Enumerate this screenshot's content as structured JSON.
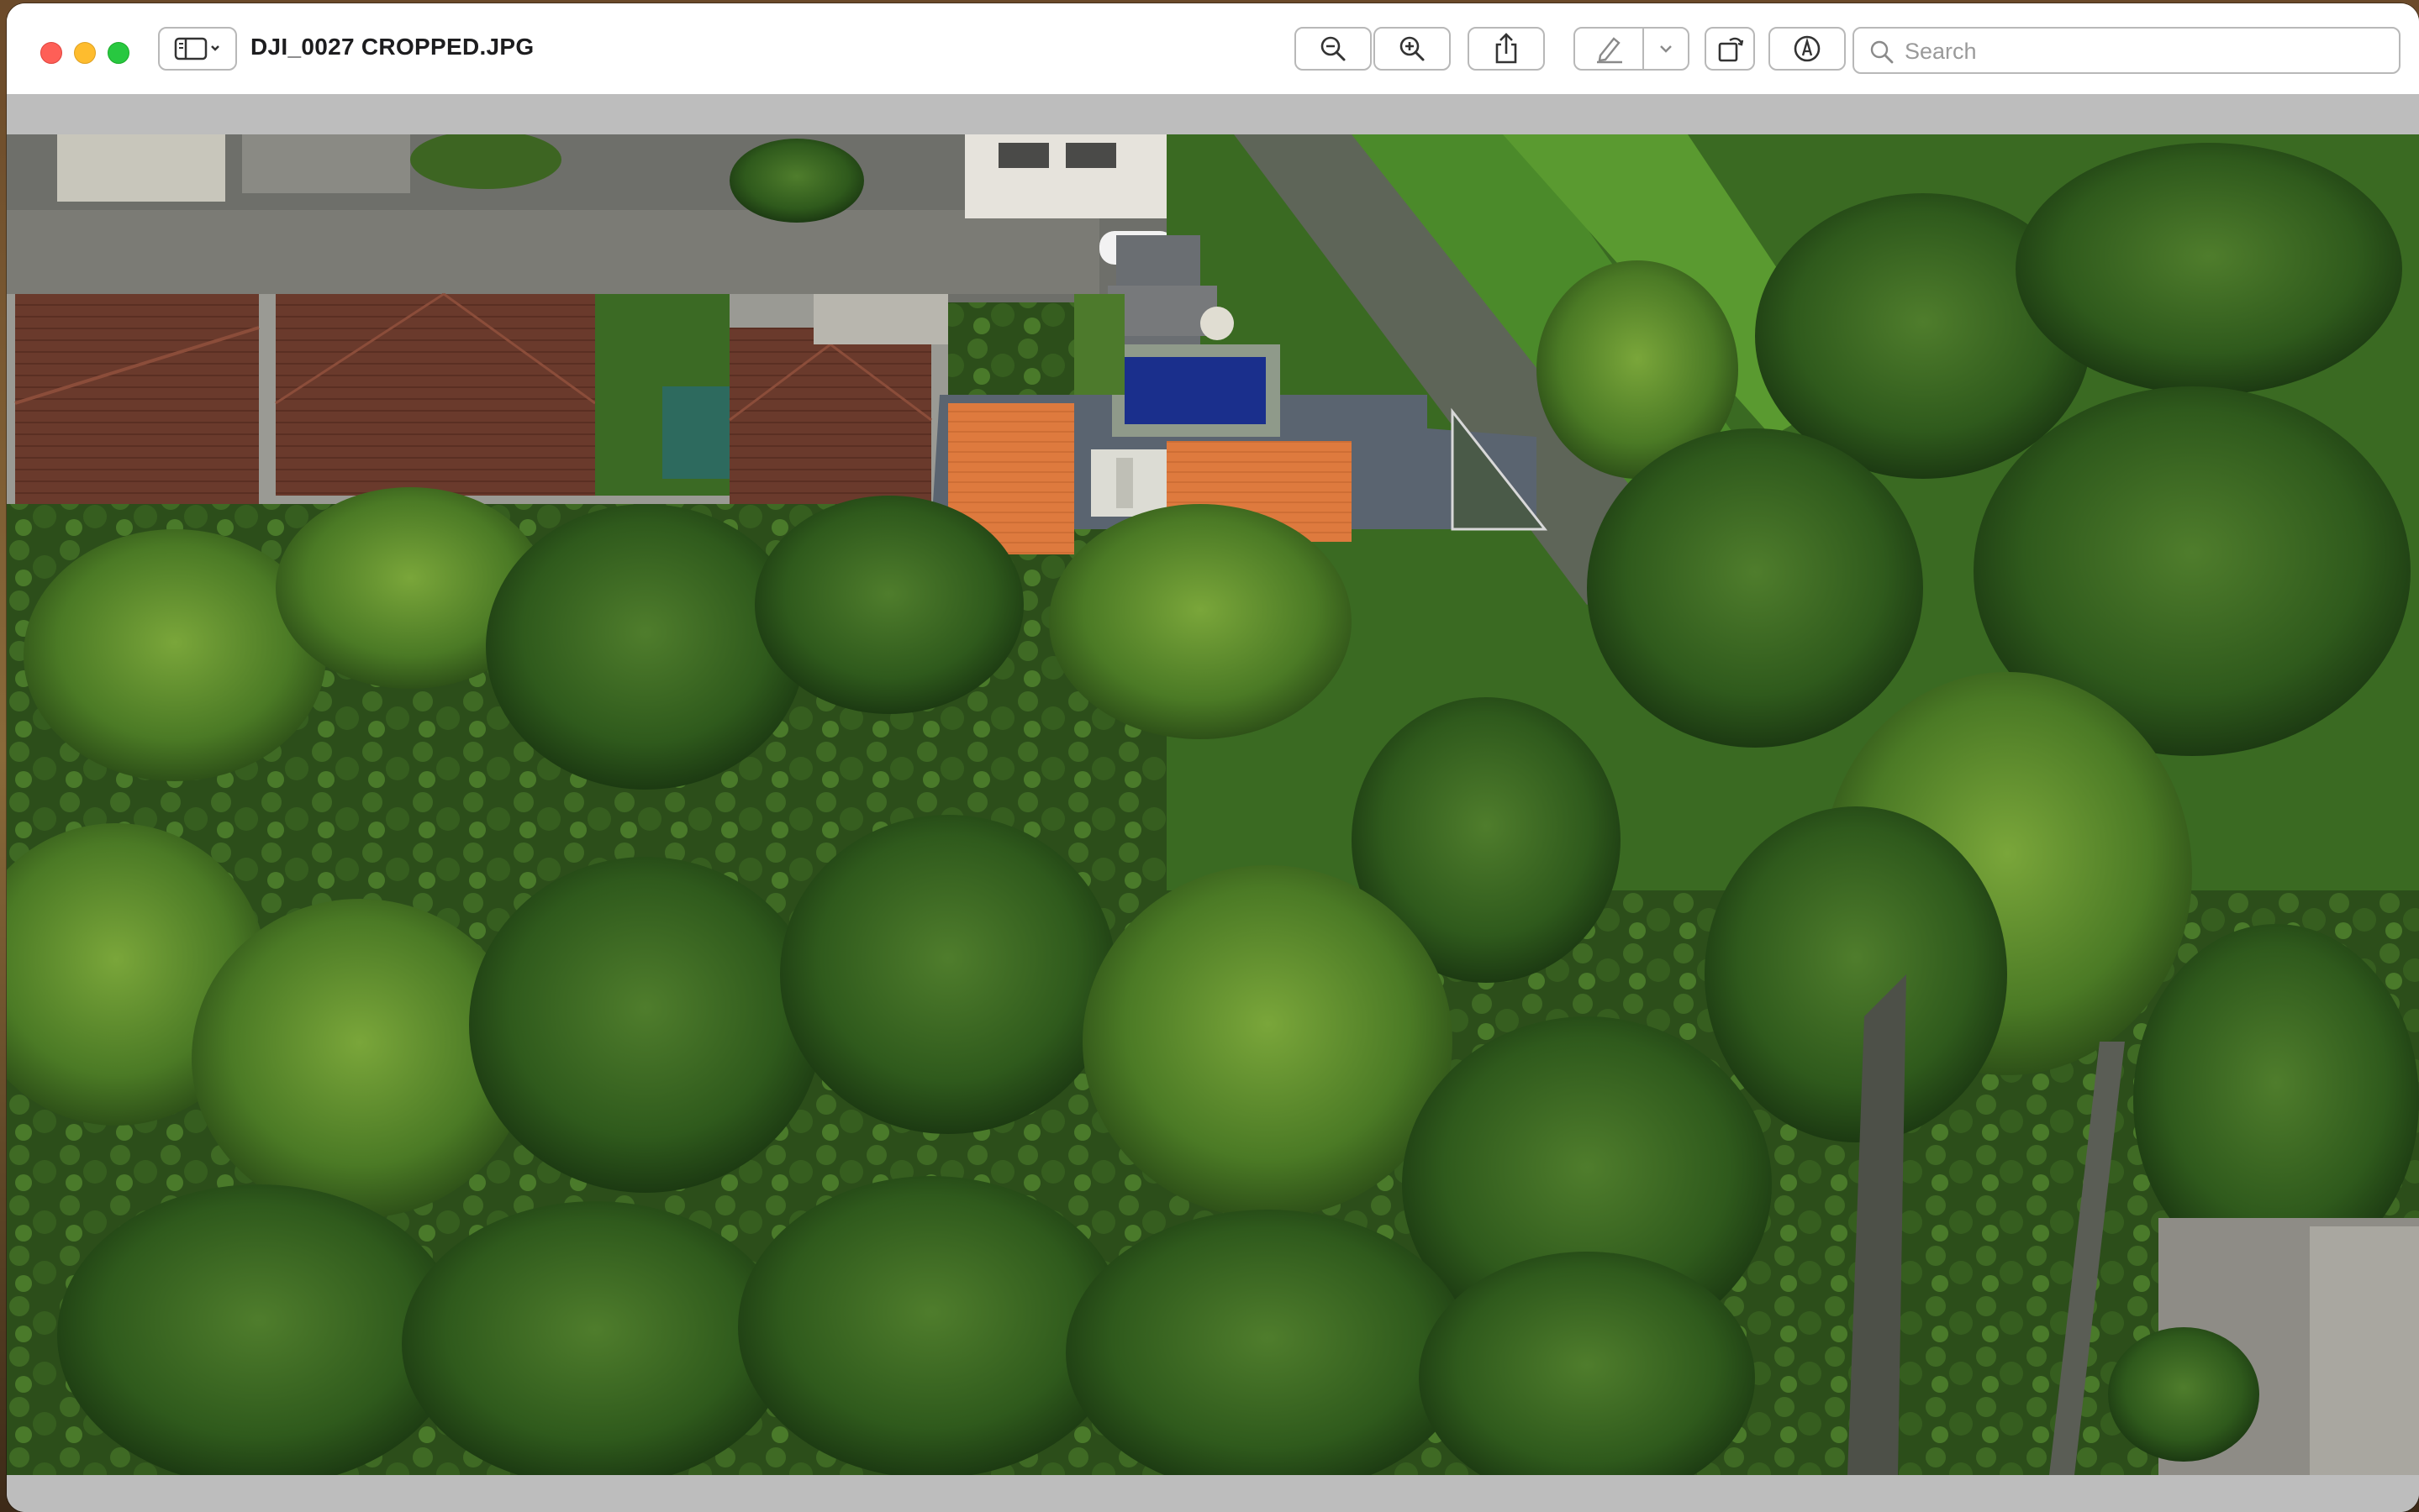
{
  "window": {
    "title": "DJI_0027 CROPPED.JPG"
  },
  "toolbar": {
    "sidebar_toggle": "sidebar-icon",
    "zoom_out": "zoom-out-icon",
    "zoom_in": "zoom-in-icon",
    "share": "share-icon",
    "markup": "pencil-icon",
    "markup_menu": "chevron-down-icon",
    "rotate": "rotate-icon",
    "annotate": "markup-circle-icon"
  },
  "search": {
    "placeholder": "Search",
    "value": ""
  },
  "colors": {
    "close": "#fe5f57",
    "minimize": "#febc2e",
    "maximize": "#28c840",
    "viewer_bg": "#bdbdbd"
  }
}
